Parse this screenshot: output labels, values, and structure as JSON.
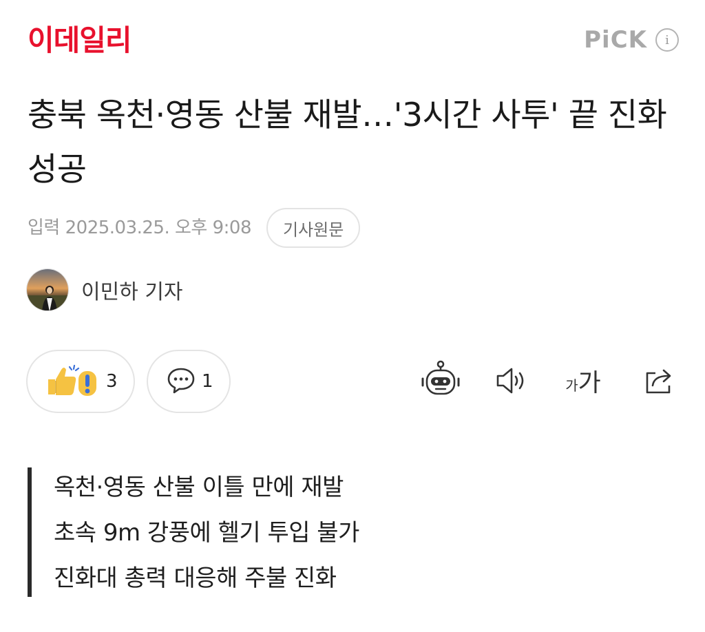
{
  "header": {
    "logo_text": "이데일리",
    "pick_label": "PiCK",
    "info_glyph": "i"
  },
  "article": {
    "title": "충북 옥천·영동 산불 재발…'3시간 사투' 끝 진화 성공",
    "date": "입력 2025.03.25. 오후 9:08",
    "original_label": "기사원문",
    "reporter": "이민하 기자"
  },
  "actions": {
    "reaction_count": "3",
    "comment_count": "1",
    "font_small": "가",
    "font_large": "가",
    "icons": [
      "reaction-icon",
      "comment-icon",
      "robot-summary-icon",
      "speaker-icon",
      "font-size-icon",
      "share-icon"
    ]
  },
  "summary": [
    "옥천·영동 산불 이틀 만에 재발",
    "초속 9m 강풍에 헬기 투입 불가",
    "진화대 총력 대응해 주불 진화"
  ],
  "colors": {
    "brand_red": "#e8112d",
    "pick_gray": "#a9a9a9",
    "text_dark": "#1e1e1e",
    "meta_gray": "#9a9a9a",
    "pill_border": "#e4e4e4",
    "reaction_yellow": "#f5c242",
    "reaction_blue": "#3a6fd8"
  }
}
